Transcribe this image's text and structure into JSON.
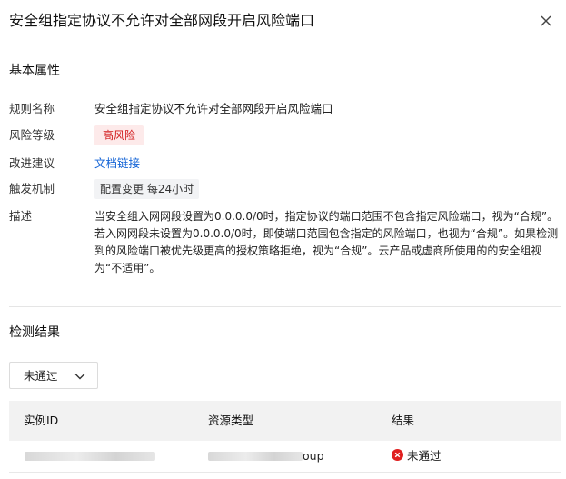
{
  "dialog": {
    "title": "安全组指定协议不允许对全部网段开启风险端口",
    "close_icon": "close-icon"
  },
  "basic": {
    "section_title": "基本属性",
    "rule_name_label": "规则名称",
    "rule_name_value": "安全组指定协议不允许对全部网段开启风险端口",
    "risk_level_label": "风险等级",
    "risk_level_value": "高风险",
    "risk_level_color": "#d2191b",
    "suggestion_label": "改进建议",
    "suggestion_link": "文档链接",
    "link_color": "#1464d6",
    "trigger_label": "触发机制",
    "trigger_value": "配置变更 每24小时",
    "desc_label": "描述",
    "desc_value": "当安全组入网网段设置为0.0.0.0/0时，指定协议的端口范围不包含指定风险端口，视为“合规”。若入网网段未设置为0.0.0.0/0时，即使端口范围包含指定的风险端口，也视为“合规”。如果检测到的风险端口被优先级更高的授权策略拒绝，视为“合规”。云产品或虚商所使用的的安全组视为“不适用”。"
  },
  "results": {
    "section_title": "检测结果",
    "filter": {
      "selected": "未通过",
      "icon": "chevron-down-icon"
    },
    "table": {
      "columns": [
        "实例ID",
        "资源类型",
        "结果"
      ],
      "rows": [
        {
          "instance_id": "",
          "resource_type": "oup",
          "result": "未通过",
          "result_icon": "error-circle-icon",
          "result_color": "#e02020"
        }
      ]
    }
  }
}
